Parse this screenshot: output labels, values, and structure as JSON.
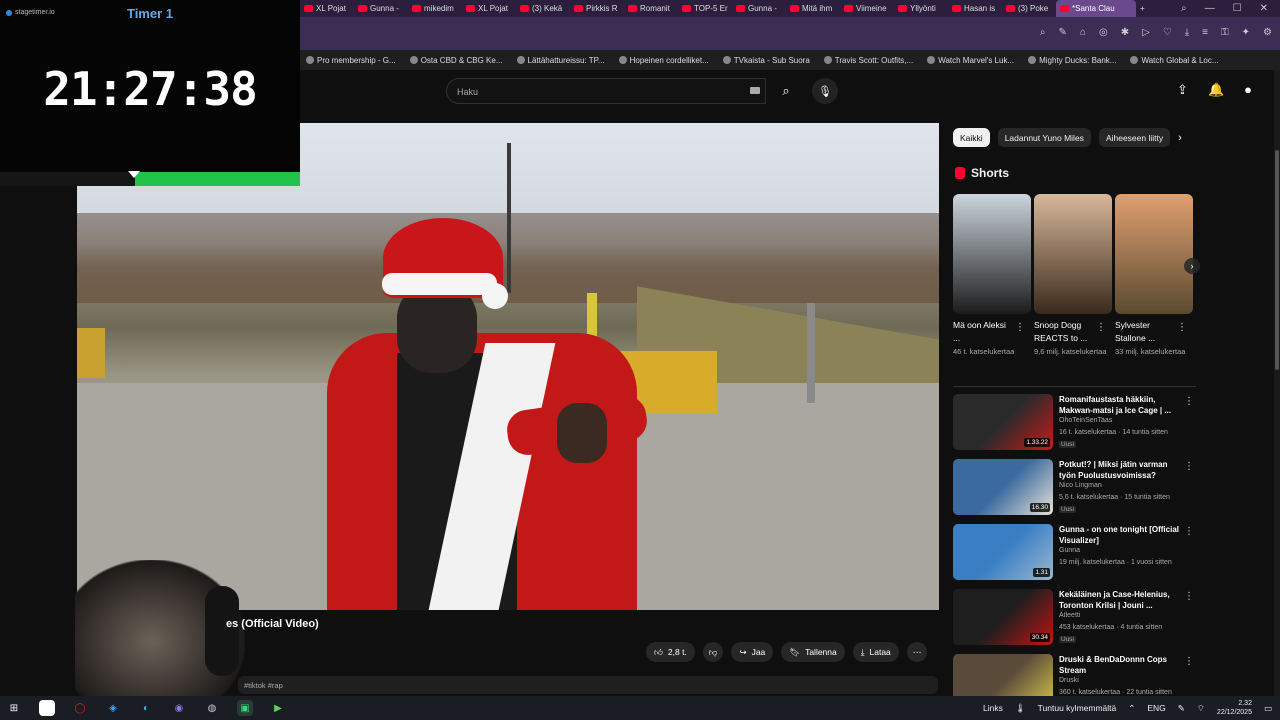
{
  "colors": {
    "accent": "#ff0033",
    "timer_blue": "#64a9e6",
    "timer_green": "#21c14a",
    "browser_bar": "#3c2d55"
  },
  "timer": {
    "brand": "stagetimer.io",
    "title": "Timer 1",
    "value": "21:27:38",
    "progress_start": 0.45,
    "progress_end": 1.0
  },
  "browser": {
    "tabs": [
      {
        "label": "XL Pojat"
      },
      {
        "label": "Gunna -"
      },
      {
        "label": "mikedim"
      },
      {
        "label": "XL Pojat"
      },
      {
        "label": "(3) Kekä"
      },
      {
        "label": "Pirkkis R"
      },
      {
        "label": "Romanit"
      },
      {
        "label": "TOP-5 Er"
      },
      {
        "label": "Gunna -"
      },
      {
        "label": "Mitä ihm"
      },
      {
        "label": "Viimeine"
      },
      {
        "label": "Yllyönti"
      },
      {
        "label": "Hasan is"
      },
      {
        "label": "(3) Poke"
      },
      {
        "label": "*Santa Clau"
      }
    ],
    "bookmarks": [
      {
        "label": "Pro membership - G..."
      },
      {
        "label": "Osta CBD & CBG Ke..."
      },
      {
        "label": "Lättähattureissu: TP..."
      },
      {
        "label": "Hopeinen cordelliket..."
      },
      {
        "label": "TVkaista - Sub Suora"
      },
      {
        "label": "Travis Scott: Outfits,..."
      },
      {
        "label": "Watch Marvel's Luk..."
      },
      {
        "label": "Mighty Ducks: Bank..."
      },
      {
        "label": "Watch Global & Loc..."
      }
    ]
  },
  "youtube": {
    "search_placeholder": "Haku",
    "video_title": "es (Official Video)",
    "description_snippet": "#tiktok #rap",
    "actions": {
      "likes": "2,8 t.",
      "share": "Jaa",
      "save": "Tallenna",
      "download": "Lataa"
    },
    "chips": [
      "Kaikki",
      "Ladannut Yuno Miles",
      "Aiheeseen liitty"
    ],
    "shorts_label": "Shorts",
    "shorts": [
      {
        "title": "Mä oon Aleksi ...",
        "views": "46 t. katselukertaa",
        "thumb_colors": [
          "#cdd6de",
          "#1b1b1b"
        ]
      },
      {
        "title": "Snoop Dogg REACTS to ...",
        "views": "9,6 milj. katselukertaa",
        "thumb_colors": [
          "#d8b89a",
          "#3a2a1c"
        ]
      },
      {
        "title": "Sylvester Stallone ...",
        "views": "33 milj. katselukertaa",
        "thumb_colors": [
          "#e0a070",
          "#5b4a30"
        ]
      }
    ],
    "recommendations": [
      {
        "title": "Romanifaustasta häkkiin, Makwan-matsi ja Ice Cage | ...",
        "channel": "OhoTeinSenTaas",
        "meta": "16 t. katselukertaa · 14 tuntia sitten",
        "badge": "Uusi",
        "duration": "1.33.22",
        "colors": [
          "#2a2a2a",
          "#c81a1a"
        ]
      },
      {
        "title": "Potkut!? | Miksi jätin varman työn Puolustusvoimissa?",
        "channel": "Nico Lingman",
        "meta": "5,6 t. katselukertaa · 15 tuntia sitten",
        "badge": "Uusi",
        "duration": "16.30",
        "colors": [
          "#3b6aa0",
          "#e8e2d8"
        ]
      },
      {
        "title": "Gunna - on one tonight [Official Visualizer]",
        "channel": "Gunna",
        "meta": "19 milj. katselukertaa · 1 vuosi sitten",
        "badge": "",
        "duration": "1.31",
        "colors": [
          "#3a7fc4",
          "#9ab7d0"
        ]
      },
      {
        "title": "Kekäläinen ja Case-Helenius, Toronton Krilsi | Jouni ...",
        "channel": "Atleetti",
        "meta": "453 katselukertaa · 4 tuntia sitten",
        "badge": "Uusi",
        "duration": "30.34",
        "colors": [
          "#1e1e1e",
          "#c41414"
        ]
      },
      {
        "title": "Druski & BenDaDonnn Cops Stream",
        "channel": "Druski",
        "meta": "360 t. katselukertaa · 22 tuntia sitten",
        "badge": "",
        "duration": "",
        "colors": [
          "#5a4a3a",
          "#d8c84a"
        ]
      }
    ]
  },
  "taskbar": {
    "links_label": "Links",
    "weather": "Tuntuu kylmemmältä",
    "lang": "ENG",
    "time": "2.32",
    "date": "22/12/2025"
  }
}
